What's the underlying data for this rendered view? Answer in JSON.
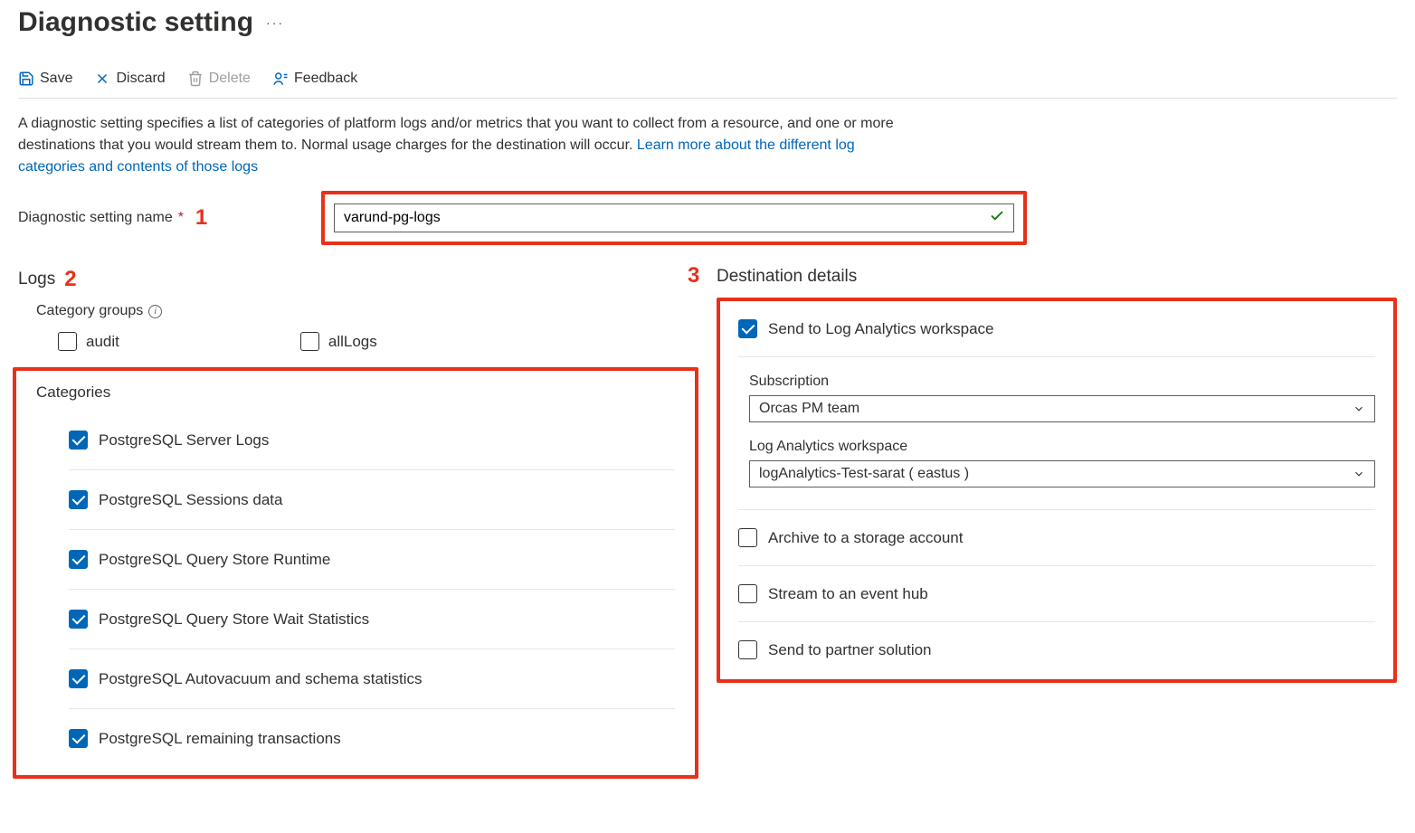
{
  "page_title": "Diagnostic setting",
  "toolbar": {
    "save": "Save",
    "discard": "Discard",
    "delete": "Delete",
    "feedback": "Feedback"
  },
  "description_part1": "A diagnostic setting specifies a list of categories of platform logs and/or metrics that you want to collect from a resource, and one or more destinations that you would stream them to. Normal usage charges for the destination will occur. ",
  "description_link": "Learn more about the different log categories and contents of those logs",
  "name_label": "Diagnostic setting name",
  "name_value": "varund-pg-logs",
  "callouts": {
    "one": "1",
    "two": "2",
    "three": "3"
  },
  "logs_header": "Logs",
  "category_groups_label": "Category groups",
  "cg": {
    "audit": "audit",
    "allLogs": "allLogs"
  },
  "categories_label": "Categories",
  "categories": [
    "PostgreSQL Server Logs",
    "PostgreSQL Sessions data",
    "PostgreSQL Query Store Runtime",
    "PostgreSQL Query Store Wait Statistics",
    "PostgreSQL Autovacuum and schema statistics",
    "PostgreSQL remaining transactions"
  ],
  "dest_header": "Destination details",
  "dest": {
    "log_analytics": "Send to Log Analytics workspace",
    "subscription_label": "Subscription",
    "subscription_value": "Orcas PM team",
    "workspace_label": "Log Analytics workspace",
    "workspace_value": "logAnalytics-Test-sarat ( eastus )",
    "storage": "Archive to a storage account",
    "eventhub": "Stream to an event hub",
    "partner": "Send to partner solution"
  }
}
